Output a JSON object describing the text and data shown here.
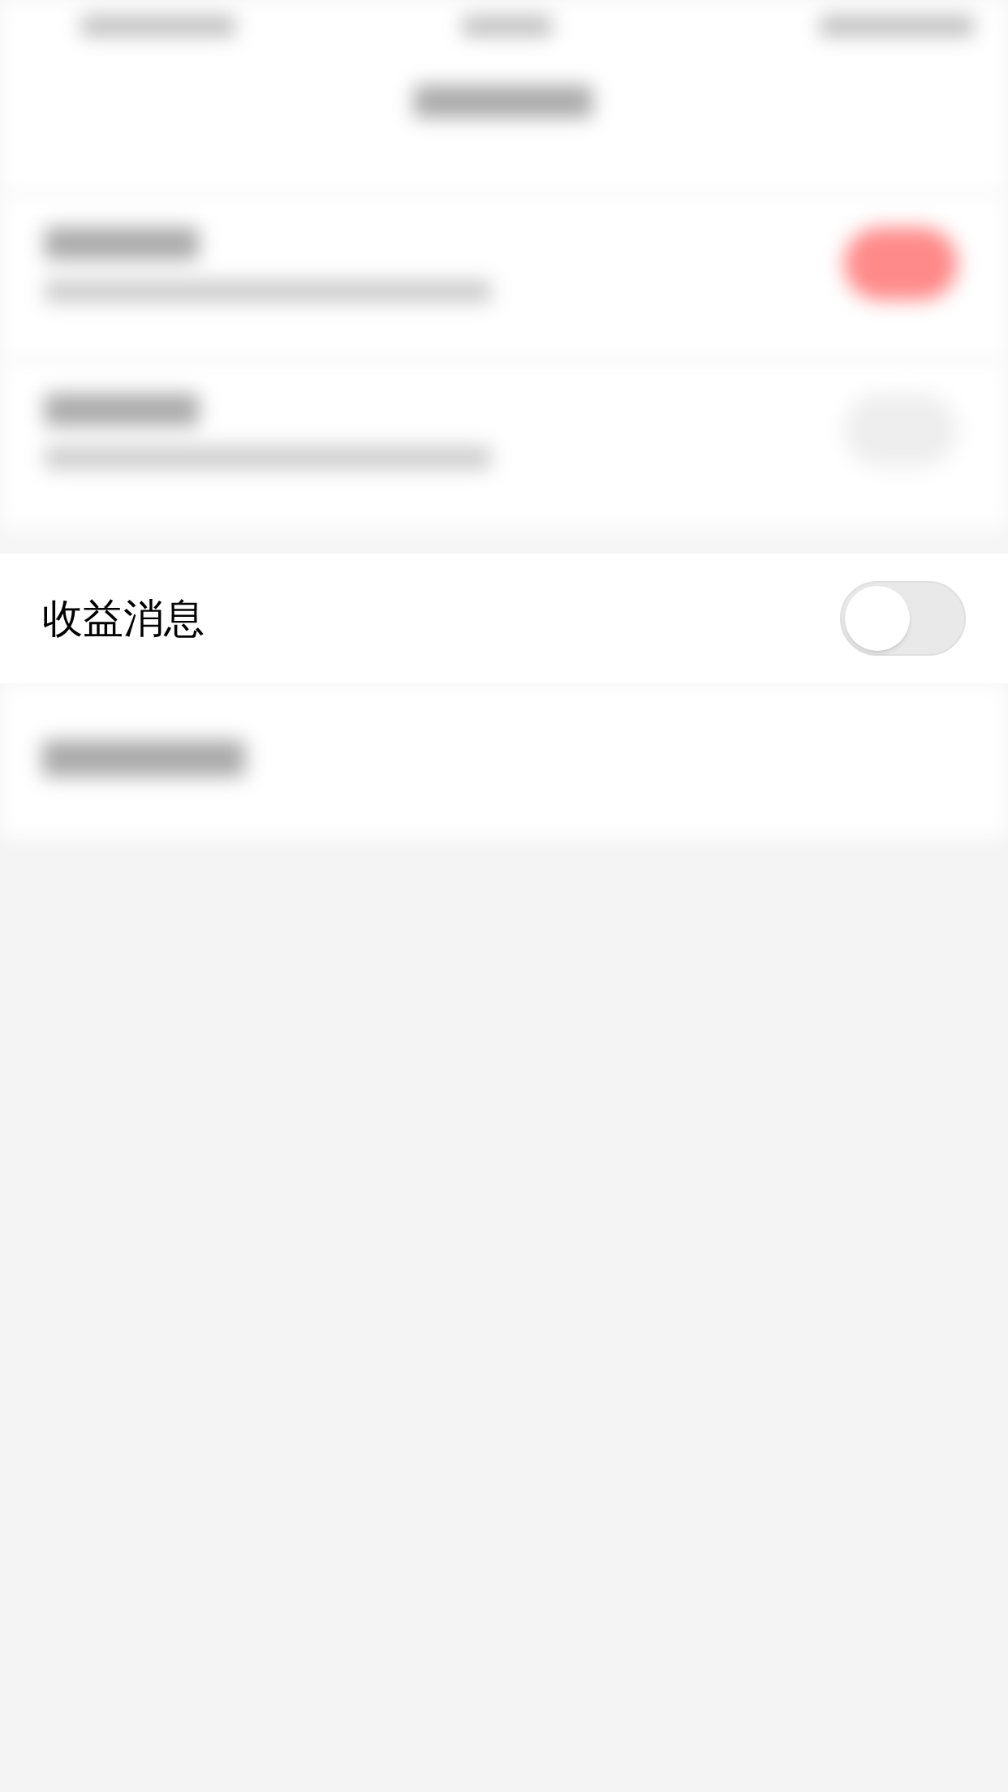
{
  "blurred_rows": [
    {
      "kind": "toggle",
      "on": true
    },
    {
      "kind": "toggle",
      "on": false
    }
  ],
  "setting": {
    "label": "收益消息",
    "on": false
  },
  "blurred_footer_rows": [
    {
      "kind": "link"
    }
  ]
}
